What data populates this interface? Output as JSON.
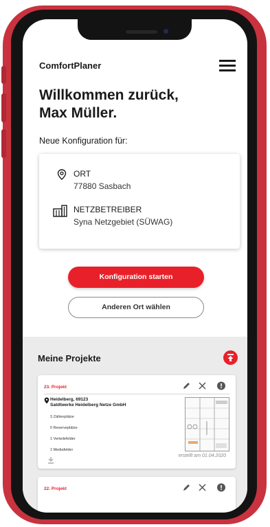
{
  "app": {
    "title": "ComfortPlaner"
  },
  "welcome": {
    "line1": "Willkommen zurück,",
    "line2": "Max Müller."
  },
  "new_config": {
    "label": "Neue Konfiguration für:"
  },
  "location": {
    "label": "ORT",
    "value": "77880 Sasbach"
  },
  "operator": {
    "label": "NETZBETREIBER",
    "value": "Syna Netzgebiet (SÜWAG)"
  },
  "buttons": {
    "start": "Konfiguration starten",
    "change_location": "Anderen Ort wählen"
  },
  "projects": {
    "title": "Meine Projekte",
    "items": [
      {
        "name": "23. Projekt",
        "location_line1": "Heidelberg, 69123",
        "location_line2": "Satdtwerke Heidelberg Netze GmbH",
        "stats": [
          "3 Zählerplätze",
          "0 Reserveplätze",
          "1 Verteilefelder",
          "1 Mediafelder"
        ],
        "created": "erstellt am 01.04.2020"
      },
      {
        "name": "22. Projekt"
      }
    ]
  },
  "colors": {
    "accent": "#e8202a",
    "phone_frame": "#c8333f"
  }
}
